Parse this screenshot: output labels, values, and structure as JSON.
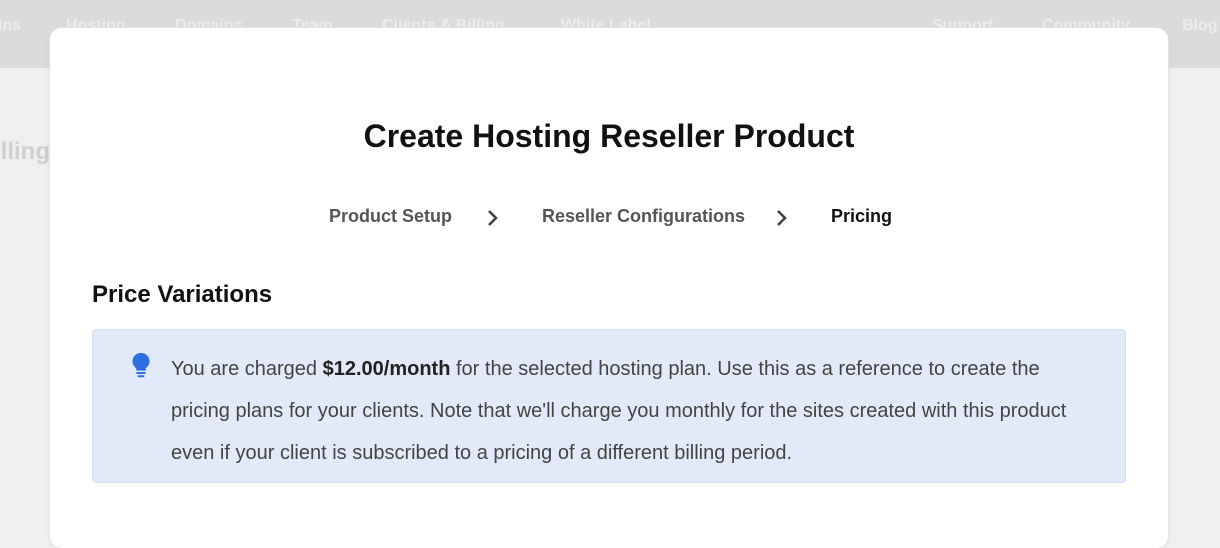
{
  "nav": {
    "items": [
      "ins",
      "Hosting",
      "Domains",
      "Team",
      "Clients & Billing",
      "White Label",
      "Support",
      "Community",
      "Blog"
    ]
  },
  "background": {
    "heading": "illing"
  },
  "modal": {
    "title": "Create Hosting Reseller Product",
    "steps": [
      {
        "label": "Product Setup",
        "active": false
      },
      {
        "label": "Reseller Configurations",
        "active": false
      },
      {
        "label": "Pricing",
        "active": true
      }
    ],
    "section_title": "Price Variations",
    "notice": {
      "icon": "lightbulb-icon",
      "text_before": "You are charged ",
      "highlight": "$12.00/month",
      "text_after": " for the selected hosting plan. Use this as a reference to create the pricing plans for your clients. Note that we'll charge you monthly for the sites created with this product even if your client is subscribed to a pricing of a different billing period."
    }
  },
  "colors": {
    "accent": "#2f6fe4",
    "notice_bg": "#e2e9f8",
    "topbar_bg": "#dbdbdb"
  }
}
